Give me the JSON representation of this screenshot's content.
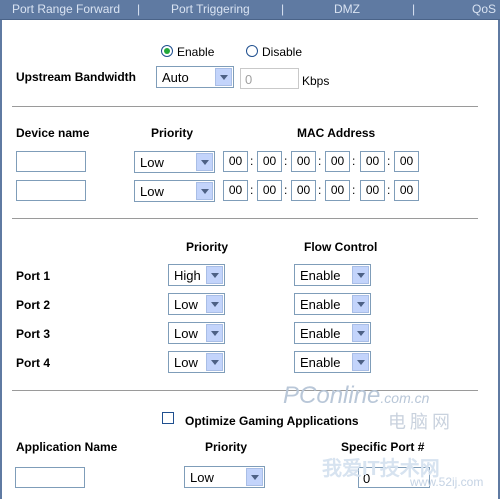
{
  "tabs": [
    {
      "label": "Port Range Forward"
    },
    {
      "label": "Port Triggering"
    },
    {
      "label": "DMZ"
    },
    {
      "label": "QoS"
    }
  ],
  "upstream": {
    "enable_label": "Enable",
    "disable_label": "Disable",
    "enabled": true,
    "label": "Upstream Bandwidth",
    "mode": "Auto",
    "value": "0",
    "unit": "Kbps"
  },
  "devices": {
    "col_name": "Device name",
    "col_priority": "Priority",
    "col_mac": "MAC Address",
    "rows": [
      {
        "name": "",
        "priority": "Low",
        "mac": [
          "00",
          "00",
          "00",
          "00",
          "00",
          "00"
        ]
      },
      {
        "name": "",
        "priority": "Low",
        "mac": [
          "00",
          "00",
          "00",
          "00",
          "00",
          "00"
        ]
      }
    ]
  },
  "ports": {
    "col_priority": "Priority",
    "col_flow": "Flow Control",
    "rows": [
      {
        "label": "Port 1",
        "priority": "High",
        "flow": "Enable"
      },
      {
        "label": "Port 2",
        "priority": "Low",
        "flow": "Enable"
      },
      {
        "label": "Port 3",
        "priority": "Low",
        "flow": "Enable"
      },
      {
        "label": "Port 4",
        "priority": "Low",
        "flow": "Enable"
      }
    ]
  },
  "gaming": {
    "checkbox_label": "Optimize Gaming Applications",
    "checked": false,
    "col_app": "Application Name",
    "col_priority": "Priority",
    "col_port": "Specific Port #",
    "row": {
      "name": "",
      "priority": "Low",
      "port": "0"
    }
  },
  "watermarks": {
    "pconline": "PConline",
    "pconline_suffix": ".com.cn",
    "cn_text": "电脑网",
    "site_cn": "我爱IT技术网",
    "site_url": "www.52ij.com"
  }
}
